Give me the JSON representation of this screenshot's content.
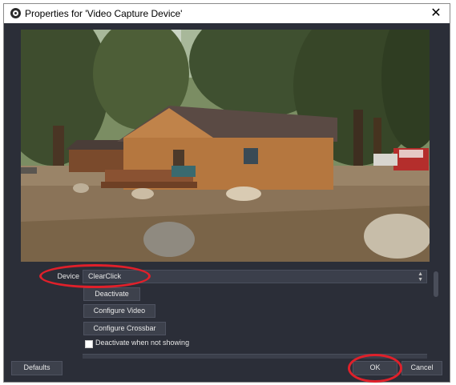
{
  "window": {
    "title": "Properties for 'Video Capture Device'",
    "close_glyph": "✕"
  },
  "form": {
    "device_label": "Device",
    "device_value": "ClearClick",
    "deactivate_label": "Deactivate",
    "configure_video_label": "Configure Video",
    "configure_crossbar_label": "Configure Crossbar",
    "deactivate_when_not_showing_label": "Deactivate when not showing",
    "deactivate_when_not_showing_checked": false
  },
  "footer": {
    "defaults_label": "Defaults",
    "ok_label": "OK",
    "cancel_label": "Cancel"
  },
  "colors": {
    "dialog_bg": "#2b2e38",
    "annotation": "#e0202a"
  },
  "icons": {
    "app": "obs-logo-icon",
    "close": "close-icon",
    "select": "updown-arrows-icon"
  }
}
